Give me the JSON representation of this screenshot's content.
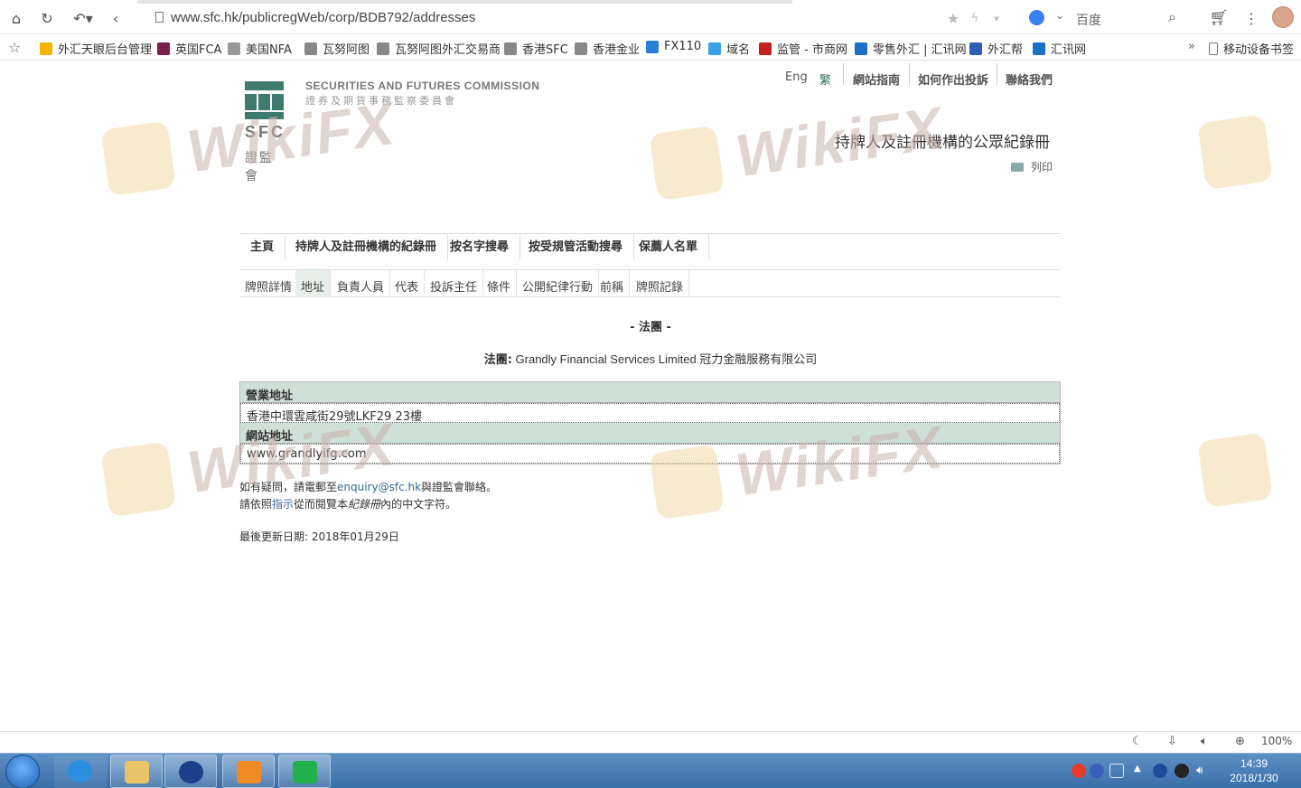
{
  "browser": {
    "url": "www.sfc.hk/publicregWeb/corp/BDB792/addresses",
    "search_engine_label": "百度",
    "zoom": "100%"
  },
  "bookmarks": [
    {
      "label": "外汇天眼后台管理",
      "color": "#f3b400"
    },
    {
      "label": "英国FCA",
      "color": "#7a1f4c"
    },
    {
      "label": "美国NFA",
      "color": "#999999"
    },
    {
      "label": "瓦努阿图",
      "color": "#888888"
    },
    {
      "label": "瓦努阿图外汇交易商",
      "color": "#888888"
    },
    {
      "label": "香港SFC",
      "color": "#888888"
    },
    {
      "label": "香港金业",
      "color": "#888888"
    },
    {
      "label": "FX110",
      "color": "#2a7fd4"
    },
    {
      "label": "域名",
      "color": "#3aa0e8"
    },
    {
      "label": "监管 - 市商网",
      "color": "#c21f1f"
    },
    {
      "label": "零售外汇 | 汇讯网",
      "color": "#1b6fc4"
    },
    {
      "label": "外汇帮",
      "color": "#2e5fb8"
    },
    {
      "label": "汇讯网",
      "color": "#1b6fc4"
    }
  ],
  "bookmarks_more": "»",
  "mobile_bookmarks": "移动设备书签",
  "sfc": {
    "logo_text": "SFC",
    "logo_cn": "證監會",
    "name_en": "SECURITIES AND FUTURES COMMISSION",
    "name_cn": "證券及期貨事務監察委員會",
    "topnav": {
      "eng": "Eng",
      "trad": "繁",
      "guide": "網站指南",
      "complaint": "如何作出投訴",
      "contact": "聯絡我們"
    },
    "heading": "持牌人及註冊機構的公眾紀錄冊",
    "print": "列印",
    "mainnav": [
      "主頁",
      "持牌人及註冊機構的紀錄冊",
      "按名字搜尋",
      "按受規管活動搜尋",
      "保薦人名單"
    ],
    "subnav": [
      "牌照詳情",
      "地址",
      "負責人員",
      "代表",
      "投訴主任",
      "條件",
      "公開紀律行動",
      "前稱",
      "牌照記錄"
    ],
    "section_title": "- 法團 -",
    "entity_label": "法團:",
    "entity_name": " Grandly Financial Services Limited 冠力金融服務有限公司",
    "business_address_header": "營業地址",
    "business_address": "香港中環雲咸街29號LKF29 23樓",
    "website_header": "網站地址",
    "website": "www.grandlyifg.com",
    "note1_pre": "如有疑問，請電郵至",
    "note1_email": "enquiry@sfc.hk",
    "note1_post": "與證監會聯絡。",
    "note2_pre": "請依照",
    "note2_link": "指示",
    "note2_mid": "從而閱覽本",
    "note2_italic": "紀錄冊",
    "note2_post": "內的中文字符。",
    "updated": "最後更新日期: 2018年01月29日"
  },
  "watermark": "WikiFX",
  "taskbar": {
    "time": "14:39",
    "date": "2018/1/30"
  }
}
